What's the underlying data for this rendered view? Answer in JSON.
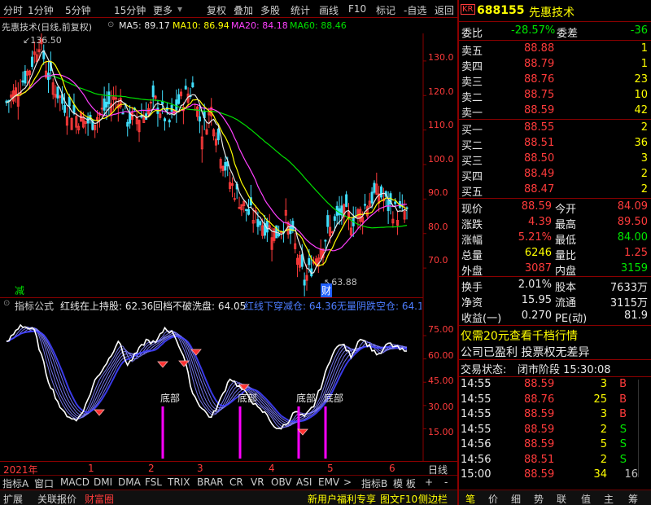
{
  "topbar": {
    "items": [
      "分时",
      "1分钟",
      "5分钟",
      "15分钟",
      "更多",
      "复权",
      "叠加",
      "多股",
      "统计",
      "画线",
      "F10",
      "标记",
      "-自选",
      "返回"
    ]
  },
  "info": {
    "stock": "先惠技术(日线,前复权)",
    "ma5": "MA5: 89.17",
    "ma10": "MA10: 86.94",
    "ma20": "MA20: 84.18",
    "ma60": "MA60: 88.46"
  },
  "price_chart": {
    "high_label": "136.50",
    "low_label": "63.88",
    "y_ticks": [
      "130.0",
      "120.0",
      "110.0",
      "100.0",
      "90.0",
      "80.0",
      "70.0"
    ],
    "left_marker": "减",
    "bottom_marker": "财"
  },
  "indicator": {
    "title": "指标公式",
    "v1": "红线在上持股: 62.36",
    "v2": "回档不破洗盘: 64.05",
    "v3": "红线下穿减仓: 64.36",
    "v4": "无量阴跌空仓: 64.1",
    "y_ticks": [
      "75.00",
      "60.00",
      "45.00",
      "30.00",
      "15.00"
    ],
    "bottom_label": "底部"
  },
  "timeline": {
    "year": "2021年",
    "months": [
      "1",
      "2",
      "3",
      "4",
      "5",
      "6"
    ],
    "right_label": "日线"
  },
  "tabs": [
    "指标A",
    "窗口",
    "MACD",
    "DMI",
    "DMA",
    "FSL",
    "TRIX",
    "BRAR",
    "CR",
    "VR",
    "OBV",
    "ASI",
    "EMV",
    ">",
    "指标B",
    "模 板",
    "+",
    "-"
  ],
  "bottom": {
    "left": [
      "扩展",
      "关联报价",
      "财富圈"
    ],
    "mid": [
      "新用户福利专享",
      "图文F10",
      "侧边栏"
    ],
    "right": [
      "笔",
      "价",
      "细",
      "势",
      "联",
      "值",
      "主",
      "筹"
    ]
  },
  "quote": {
    "badge": "KR",
    "code": "688155",
    "name": "先惠技术",
    "wb_label": "委比",
    "wb_value": "-28.57%",
    "wc_label": "委差",
    "wc_value": "-36",
    "sell": [
      {
        "label": "卖五",
        "price": "88.88",
        "vol": "1"
      },
      {
        "label": "卖四",
        "price": "88.79",
        "vol": "1"
      },
      {
        "label": "卖三",
        "price": "88.76",
        "vol": "23"
      },
      {
        "label": "卖二",
        "price": "88.75",
        "vol": "10"
      },
      {
        "label": "卖一",
        "price": "88.59",
        "vol": "42"
      }
    ],
    "buy": [
      {
        "label": "买一",
        "price": "88.55",
        "vol": "2"
      },
      {
        "label": "买二",
        "price": "88.51",
        "vol": "36"
      },
      {
        "label": "买三",
        "price": "88.50",
        "vol": "3"
      },
      {
        "label": "买四",
        "price": "88.49",
        "vol": "2"
      },
      {
        "label": "买五",
        "price": "88.47",
        "vol": "2"
      }
    ],
    "stats": [
      {
        "l1": "现价",
        "v1": "88.59",
        "c1": "red",
        "l2": "今开",
        "v2": "84.09",
        "c2": "red"
      },
      {
        "l1": "涨跌",
        "v1": "4.39",
        "c1": "red",
        "l2": "最高",
        "v2": "89.50",
        "c2": "red"
      },
      {
        "l1": "涨幅",
        "v1": "5.21%",
        "c1": "red",
        "l2": "最低",
        "v2": "84.00",
        "c2": "green"
      },
      {
        "l1": "总量",
        "v1": "6246",
        "c1": "yellow",
        "l2": "量比",
        "v2": "1.25",
        "c2": "red"
      },
      {
        "l1": "外盘",
        "v1": "3087",
        "c1": "red",
        "l2": "内盘",
        "v2": "3159",
        "c2": "green"
      }
    ],
    "stats2": [
      {
        "l1": "换手",
        "v1": "2.01%",
        "l2": "股本",
        "v2": "7633万"
      },
      {
        "l1": "净资",
        "v1": "15.95",
        "l2": "流通",
        "v2": "3115万"
      },
      {
        "l1": "收益(一)",
        "v1": "0.270",
        "l2": "PE(动)",
        "v2": "81.9"
      }
    ],
    "promo": "仅需20元查看千档行情",
    "profit": "公司已盈利 投票权无差异",
    "status_label": "交易状态:",
    "status_value": "闭市阶段 15:30:08",
    "ticks": [
      {
        "t": "14:55",
        "p": "88.59",
        "v": "3",
        "s": "B"
      },
      {
        "t": "14:55",
        "p": "88.76",
        "v": "25",
        "s": "B"
      },
      {
        "t": "14:55",
        "p": "88.59",
        "v": "3",
        "s": "B"
      },
      {
        "t": "14:55",
        "p": "88.59",
        "v": "2",
        "s": "S"
      },
      {
        "t": "14:56",
        "p": "88.59",
        "v": "5",
        "s": "S"
      },
      {
        "t": "14:56",
        "p": "88.51",
        "v": "2",
        "s": "S"
      },
      {
        "t": "15:00",
        "p": "88.59",
        "v": "34",
        "s": "16"
      }
    ]
  },
  "colors": {
    "ma5": "#e8e8e8",
    "ma10": "#ffff00",
    "ma20": "#ff40ff",
    "ma60": "#00e000",
    "up": "#ff3b3b",
    "down": "#40e0ff",
    "ind_main": "#ffffff",
    "ind_band": "#4040ff",
    "bottom_bar": "#ff00ff"
  }
}
